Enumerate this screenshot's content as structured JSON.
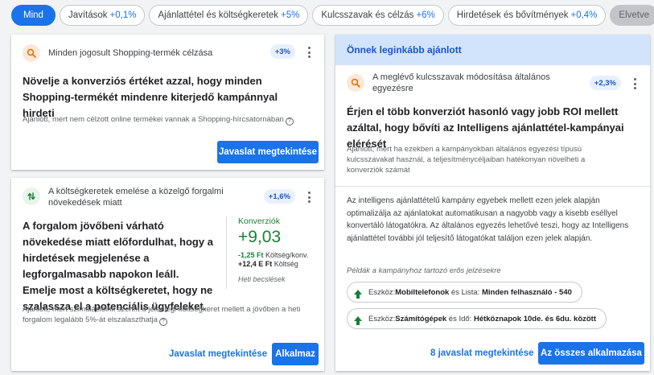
{
  "filters": [
    {
      "label": "Mind",
      "pct": "",
      "state": "active"
    },
    {
      "label": "Javítások",
      "pct": "+0,1%",
      "state": "normal"
    },
    {
      "label": "Ajánlattétel és költségkeretek",
      "pct": "+5%",
      "state": "normal"
    },
    {
      "label": "Kulcsszavak és célzás",
      "pct": "+6%",
      "state": "normal"
    },
    {
      "label": "Hirdetések és bővítmények",
      "pct": "+0,4%",
      "state": "normal"
    },
    {
      "label": "Elvetve",
      "pct": "",
      "state": "muted"
    }
  ],
  "card_shopping": {
    "head_title": "Minden jogosult Shopping-termék célzása",
    "badge": "+3%",
    "title": "Növelje a konverziós értéket azzal, hogy minden Shopping-termékét mindenre kiterjedő kampánnyal hirdeti",
    "note": "Ajánlott, mert nem célzott online termékei vannak a Shopping-hírcsatornában",
    "button": "Javaslat megtekintése"
  },
  "card_budget": {
    "head_title": "A költségkeretek emelése a közelgő forgalmi növekedések miatt",
    "badge": "+1,6%",
    "title": "A forgalom jövőbeni várható növekedése miatt előfordulhat, hogy a hirdetések megjelenése a legforgalmasabb napokon leáll. Emelje most a költségkeretet, hogy ne szalassza el a potenciális ügyfeleket.",
    "metric_label": "Konverziók",
    "metric_value": "+9,03",
    "cost_per_conv_value": "-1,25 Ft",
    "cost_per_conv_label": " Költség/konv.",
    "cost_value": "+12,4 E Ft",
    "cost_label": " Költség",
    "estimate_note": "Heti becslések",
    "note": "Ajánlott, mert szimulációink szerint a jelenlegi költségkeret mellett a jövőben a heti forgalom legalább 5%-át elszalaszthatja",
    "view_button": "Javaslat megtekintése",
    "apply_button": "Alkalmaz"
  },
  "card_keywords": {
    "banner": "Önnek leginkább ajánlott",
    "head_title": "A meglévő kulcsszavak módosítása általános egyezésre",
    "badge": "+2,3%",
    "title": "Érjen el több konverziót hasonló vagy jobb ROI mellett azáltal, hogy bővíti az Intelligens ajánlattétel-kampányai elérését",
    "note": "Ajánlott, mert ha ezekben a kampányokban általános egyezési típusú kulcsszavakat használ, a teljesítménycéljaiban hatékonyan növelheti a konverziók számát",
    "description": "Az intelligens ajánlattételű kampány egyebek mellett ezen jelek alapján optimalizálja az ajánlatokat automatikusan a nagyobb vagy a kisebb eséllyel konvertáló látogatókra. Az általános egyezés lehetővé teszi, hogy az Intelligens ajánlattétel további jól teljesítő látogatókat találjon ezen jelek alapján.",
    "signals_heading": "Példák a kampányhoz tartozó erős jelzésekre",
    "signals": [
      {
        "p1": "Eszköz: ",
        "b1": "Mobiltelefonok",
        "p2": " és Lista: ",
        "b2": "Minden felhasználó - 540"
      },
      {
        "p1": "Eszköz: ",
        "b1": "Számítógépek",
        "p2": " és Idő: ",
        "b2": "Hétköznapok 10de. és 6du. között"
      }
    ],
    "view_button": "8 javaslat megtekintése",
    "apply_button": "Az összes alkalmazása"
  }
}
